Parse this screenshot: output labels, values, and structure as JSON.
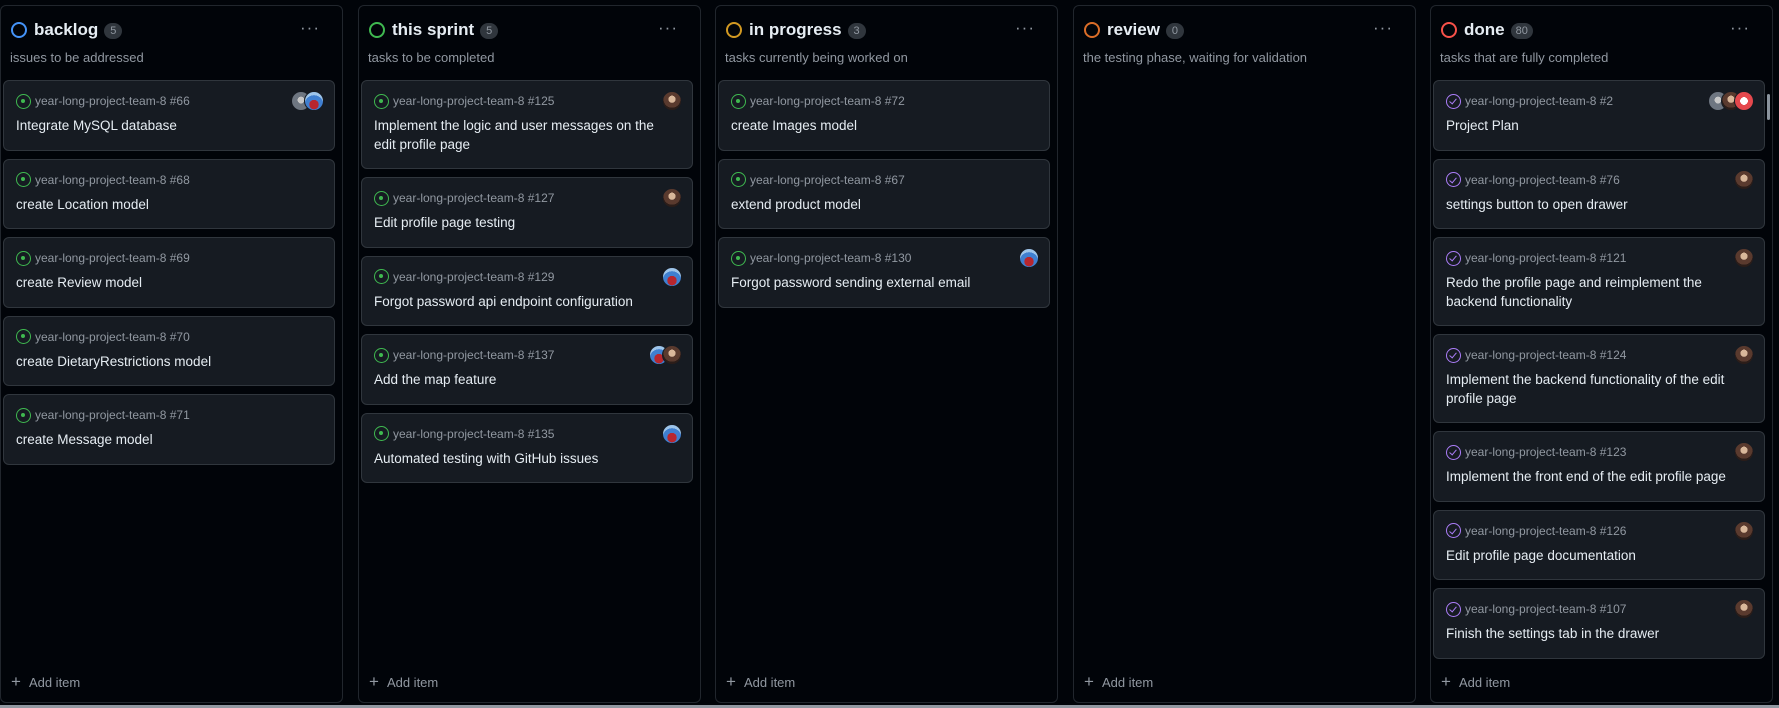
{
  "columns": [
    {
      "title": "backlog",
      "count": "5",
      "color": "#4493f8",
      "description": "issues to be addressed",
      "menu": "···",
      "add_item": "Add item",
      "cards": [
        {
          "ref": "year-long-project-team-8 #66",
          "title": "Integrate MySQL database",
          "state": "open",
          "avatars": [
            "grey",
            "blue"
          ]
        },
        {
          "ref": "year-long-project-team-8 #68",
          "title": "create Location model",
          "state": "open",
          "avatars": []
        },
        {
          "ref": "year-long-project-team-8 #69",
          "title": "create Review model",
          "state": "open",
          "avatars": []
        },
        {
          "ref": "year-long-project-team-8 #70",
          "title": "create DietaryRestrictions model",
          "state": "open",
          "avatars": []
        },
        {
          "ref": "year-long-project-team-8 #71",
          "title": "create Message model",
          "state": "open",
          "avatars": []
        }
      ]
    },
    {
      "title": "this sprint",
      "count": "5",
      "color": "#3fb950",
      "description": "tasks to be completed",
      "menu": "···",
      "add_item": "Add item",
      "cards": [
        {
          "ref": "year-long-project-team-8 #125",
          "title": "Implement the logic and user messages on the edit profile page",
          "state": "open",
          "avatars": [
            "brown"
          ]
        },
        {
          "ref": "year-long-project-team-8 #127",
          "title": "Edit profile page testing",
          "state": "open",
          "avatars": [
            "brown"
          ]
        },
        {
          "ref": "year-long-project-team-8 #129",
          "title": "Forgot password api endpoint configuration",
          "state": "open",
          "avatars": [
            "blue"
          ]
        },
        {
          "ref": "year-long-project-team-8 #137",
          "title": "Add the map feature",
          "state": "open",
          "avatars": [
            "blue",
            "brown"
          ]
        },
        {
          "ref": "year-long-project-team-8 #135",
          "title": "Automated testing with GitHub issues",
          "state": "open",
          "avatars": [
            "blue"
          ]
        }
      ]
    },
    {
      "title": "in progress",
      "count": "3",
      "color": "#d29922",
      "description": "tasks currently being worked on",
      "menu": "···",
      "add_item": "Add item",
      "cards": [
        {
          "ref": "year-long-project-team-8 #72",
          "title": "create Images model",
          "state": "open",
          "avatars": []
        },
        {
          "ref": "year-long-project-team-8 #67",
          "title": "extend product model",
          "state": "open",
          "avatars": []
        },
        {
          "ref": "year-long-project-team-8 #130",
          "title": "Forgot password sending external email",
          "state": "open",
          "avatars": [
            "blue"
          ]
        }
      ]
    },
    {
      "title": "review",
      "count": "0",
      "color": "#db6d28",
      "description": "the testing phase, waiting for validation",
      "menu": "···",
      "add_item": "Add item",
      "cards": []
    },
    {
      "title": "done",
      "count": "80",
      "color": "#f85149",
      "description": "tasks that are fully completed",
      "menu": "···",
      "add_item": "Add item",
      "cards": [
        {
          "ref": "year-long-project-team-8 #2",
          "title": "Project Plan",
          "state": "closed",
          "avatars": [
            "grey",
            "brown",
            "red"
          ]
        },
        {
          "ref": "year-long-project-team-8 #76",
          "title": "settings button to open drawer",
          "state": "closed",
          "avatars": [
            "brown"
          ]
        },
        {
          "ref": "year-long-project-team-8 #121",
          "title": "Redo the profile page and reimplement the backend functionality",
          "state": "closed",
          "avatars": [
            "brown"
          ]
        },
        {
          "ref": "year-long-project-team-8 #124",
          "title": "Implement the backend functionality of the edit profile page",
          "state": "closed",
          "avatars": [
            "brown"
          ]
        },
        {
          "ref": "year-long-project-team-8 #123",
          "title": "Implement the front end of the edit profile page",
          "state": "closed",
          "avatars": [
            "brown"
          ]
        },
        {
          "ref": "year-long-project-team-8 #126",
          "title": "Edit profile page documentation",
          "state": "closed",
          "avatars": [
            "brown"
          ]
        },
        {
          "ref": "year-long-project-team-8 #107",
          "title": "Finish the settings tab in the drawer",
          "state": "closed",
          "avatars": [
            "brown"
          ]
        }
      ]
    }
  ]
}
